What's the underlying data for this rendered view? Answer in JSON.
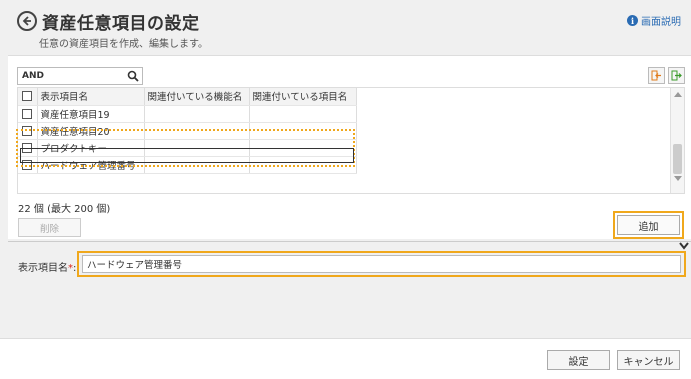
{
  "header": {
    "title": "資産任意項目の設定",
    "subtitle": "任意の資産項目を作成、編集します。",
    "help_label": "画面説明",
    "help_icon": "info-icon"
  },
  "search": {
    "value": "AND",
    "icon": "search-icon"
  },
  "export_buttons": [
    {
      "icon": "import-icon"
    },
    {
      "icon": "export-icon"
    }
  ],
  "table": {
    "columns": [
      "表示項目名",
      "関連付いている機能名",
      "関連付いている項目名"
    ],
    "rows": [
      {
        "name": "資産任意項目19",
        "feature": "",
        "item": ""
      },
      {
        "name": "資産任意項目20",
        "feature": "",
        "item": ""
      },
      {
        "name": "プロダクトキー",
        "feature": "",
        "item": ""
      },
      {
        "name": "ハードウェア管理番号",
        "feature": "",
        "item": ""
      }
    ]
  },
  "count_text": "22 個 (最大 200 個)",
  "buttons": {
    "delete": "削除",
    "add": "追加",
    "set": "設定",
    "cancel": "キャンセル"
  },
  "form": {
    "label": "表示項目名",
    "required_mark": "*",
    "colon": ":",
    "value": "ハードウェア管理番号"
  },
  "colors": {
    "highlight": "#f0a81c",
    "link": "#2a6bb3",
    "required": "#d9261c"
  }
}
